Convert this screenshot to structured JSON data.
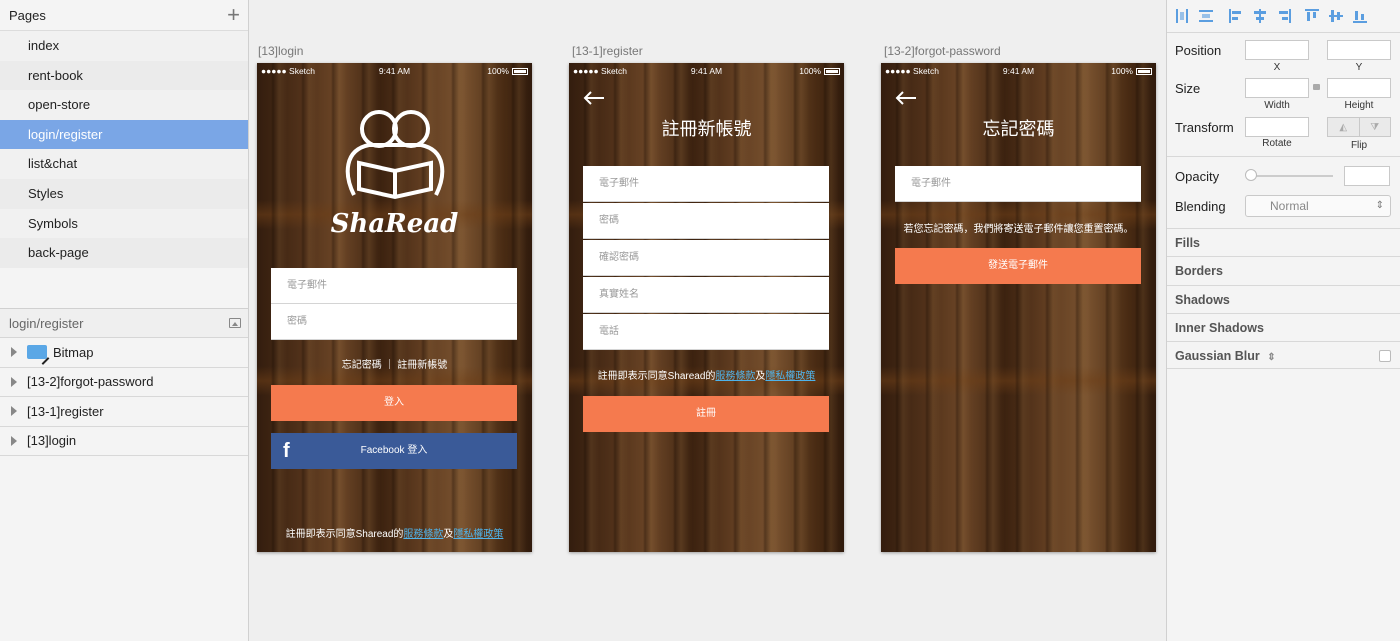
{
  "left_panel": {
    "pages_title": "Pages",
    "add_symbol": "+",
    "pages": [
      {
        "label": "index"
      },
      {
        "label": "rent-book"
      },
      {
        "label": "open-store"
      },
      {
        "label": "login/register"
      },
      {
        "label": "list&chat"
      },
      {
        "label": "Styles"
      },
      {
        "label": "Symbols"
      },
      {
        "label": "back-page"
      }
    ],
    "selected_page": "login/register",
    "layers_title": "login/register",
    "layers": [
      {
        "label": "Bitmap"
      },
      {
        "label": "[13-2]forgot-password"
      },
      {
        "label": "[13-1]register"
      },
      {
        "label": "[13]login"
      }
    ]
  },
  "artboards": {
    "login": {
      "title": "[13]login",
      "status": {
        "carrier": "●●●●● Sketch",
        "time": "9:41 AM",
        "battery": "100%"
      },
      "brand": "ShaRead",
      "email_placeholder": "電子郵件",
      "password_placeholder": "密碼",
      "links": "忘記密碼 ｜ 註冊新帳號",
      "login_button": "登入",
      "facebook_button": "Facebook 登入",
      "facebook_icon": "f",
      "terms_prefix": "註冊即表示同意Sharead的",
      "terms_link": "服務條款",
      "terms_and": "及",
      "privacy_link": "隱私權政策"
    },
    "register": {
      "title": "[13-1]register",
      "status": {
        "carrier": "●●●●● Sketch",
        "time": "9:41 AM",
        "battery": "100%"
      },
      "heading": "註冊新帳號",
      "fields": [
        "電子郵件",
        "密碼",
        "確認密碼",
        "真實姓名",
        "電話"
      ],
      "terms_prefix": "註冊即表示同意Sharead的",
      "terms_link": "服務條款",
      "terms_and": "及",
      "privacy_link": "隱私權政策",
      "submit_button": "註冊"
    },
    "forgot": {
      "title": "[13-2]forgot-password",
      "status": {
        "carrier": "●●●●● Sketch",
        "time": "9:41 AM",
        "battery": "100%"
      },
      "heading": "忘記密碼",
      "email_placeholder": "電子郵件",
      "hint": "若您忘記密碼，我們將寄送電子郵件讓您重置密碼。",
      "send_button": "發送電子郵件"
    }
  },
  "inspector": {
    "position_label": "Position",
    "x_caption": "X",
    "y_caption": "Y",
    "size_label": "Size",
    "width_caption": "Width",
    "height_caption": "Height",
    "transform_label": "Transform",
    "rotate_caption": "Rotate",
    "flip_caption": "Flip",
    "opacity_label": "Opacity",
    "blending_label": "Blending",
    "blending_value": "Normal",
    "sections": [
      "Fills",
      "Borders",
      "Shadows",
      "Inner Shadows",
      "Gaussian Blur"
    ]
  },
  "colors": {
    "accent_orange": "#f57a4e",
    "facebook_blue": "#3a5a98",
    "selection_blue": "#7aa6e6",
    "link_blue": "#4fb3ea"
  }
}
